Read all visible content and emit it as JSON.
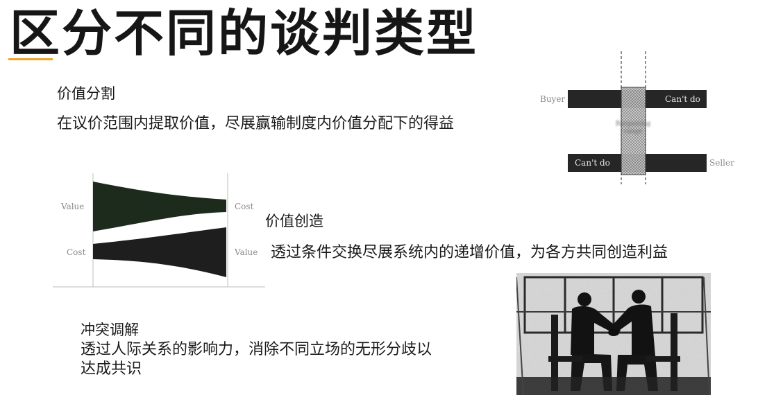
{
  "slide": {
    "title": "区分不同的谈判类型",
    "accent_color": "#f0a32a"
  },
  "value_distribution": {
    "heading": "价值分割",
    "description": "在议价范围内提取价值，尽展赢输制度内价值分配下的得益",
    "diagram": {
      "buyer_label": "Buyer",
      "seller_label": "Seller",
      "buyer_bar_text": "Can't do",
      "seller_bar_text": "Can't do",
      "zone_label": "Bargaining range"
    }
  },
  "value_creation": {
    "heading": "价值创造",
    "description": "透过条件交换尽展系统内的递增价值，为各方共同创造利益",
    "diagram": {
      "left_top_label": "Value",
      "left_bottom_label": "Cost",
      "right_top_label": "Cost",
      "right_bottom_label": "Value",
      "top_band_color": "#1d2b1d",
      "bottom_band_color": "#1e1e1e"
    }
  },
  "conflict_resolution": {
    "heading": "冲突调解",
    "description_line1": "透过人际关系的影响力，消除不同立场的无形分歧以",
    "description_line2": "达成共识"
  }
}
